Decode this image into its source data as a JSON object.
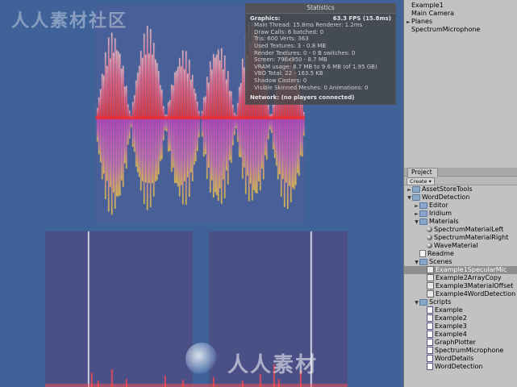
{
  "statistics": {
    "title": "Statistics",
    "graphics_label": "Graphics:",
    "fps": "63.3 FPS (15.8ms)",
    "lines": [
      "Main Thread: 15.8ms  Renderer: 1.2ms",
      "Draw Calls: 6  batched: 0",
      "Tris: 600  Verts: 363",
      "Used Textures: 3 - 0.8 MB",
      "Render Textures: 0 - 0 B  switches: 0",
      "Screen: 796x950 - 8.7 MB",
      "VRAM usage: 8.7 MB to 9.6 MB (of 1.95 GB)",
      "VBO Total: 22 - 163.5 KB",
      "Shadow Casters: 0",
      "Visible Skinned Meshes: 0     Animations: 0"
    ],
    "network": "Network: (no players connected)"
  },
  "hierarchy": {
    "items": [
      "Example1",
      "Main Camera",
      "Planes",
      "SpectrumMicrophone"
    ]
  },
  "project": {
    "tab_label": "Project",
    "create_label": "Create",
    "tree": [
      {
        "label": "AssetStoreTools",
        "type": "folder",
        "depth": 0,
        "expander": "►"
      },
      {
        "label": "WordDetection",
        "type": "folder",
        "depth": 0,
        "expander": "▼"
      },
      {
        "label": "Editor",
        "type": "folder",
        "depth": 1,
        "expander": "►"
      },
      {
        "label": "Iridium",
        "type": "folder",
        "depth": 1,
        "expander": "►"
      },
      {
        "label": "Materials",
        "type": "folder",
        "depth": 1,
        "expander": "▼"
      },
      {
        "label": "SpectrumMaterialLeft",
        "type": "material",
        "depth": 2
      },
      {
        "label": "SpectrumMaterialRight",
        "type": "material",
        "depth": 2
      },
      {
        "label": "WaveMaterial",
        "type": "material",
        "depth": 2
      },
      {
        "label": "Readme",
        "type": "doc",
        "depth": 1
      },
      {
        "label": "Scenes",
        "type": "folder",
        "depth": 1,
        "expander": "▼"
      },
      {
        "label": "Example1SpecularMic",
        "type": "scene",
        "depth": 2,
        "selected": true
      },
      {
        "label": "Example2ArrayCopy",
        "type": "scene",
        "depth": 2
      },
      {
        "label": "Example3MaterialOffset",
        "type": "scene",
        "depth": 2
      },
      {
        "label": "Example4WordDetection",
        "type": "scene",
        "depth": 2
      },
      {
        "label": "Scripts",
        "type": "folder",
        "depth": 1,
        "expander": "▼"
      },
      {
        "label": "Example",
        "type": "script",
        "depth": 2
      },
      {
        "label": "Example2",
        "type": "script",
        "depth": 2
      },
      {
        "label": "Example3",
        "type": "script",
        "depth": 2
      },
      {
        "label": "Example4",
        "type": "script",
        "depth": 2
      },
      {
        "label": "GraphPlotter",
        "type": "script",
        "depth": 2
      },
      {
        "label": "SpectrumMicrophone",
        "type": "script",
        "depth": 2
      },
      {
        "label": "WordDetails",
        "type": "script",
        "depth": 2
      },
      {
        "label": "WordDetection",
        "type": "script",
        "depth": 2
      }
    ]
  },
  "watermark": {
    "top": "人人素材社区",
    "bottom": "人人素材"
  },
  "colors": {
    "game_bg": "#3f6399",
    "spectrum_top": "#ff2a2a",
    "spectrum_mid": "#d040c0",
    "spectrum_bottom": "#ffd23a",
    "graph_bg": "#4a4f86",
    "panel_bg": "#c2c2c2",
    "selection": "#8f8f8f"
  }
}
